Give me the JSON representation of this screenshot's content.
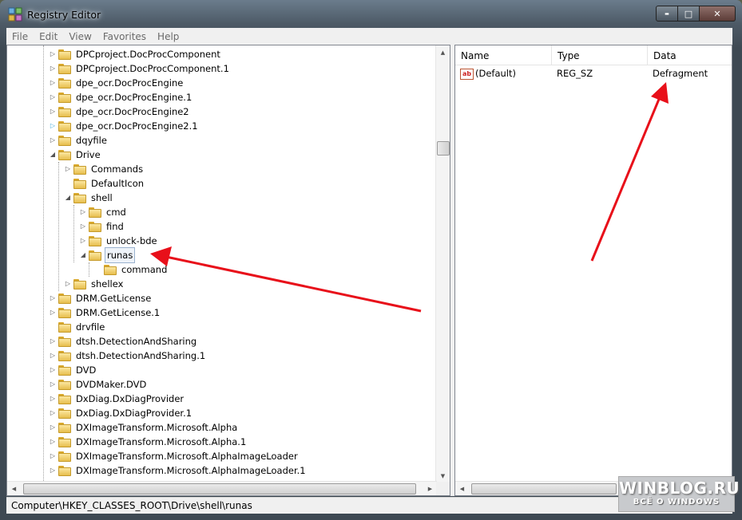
{
  "window": {
    "title": "Registry Editor",
    "icon": "regedit-icon"
  },
  "caption_buttons": {
    "minimize": "▬",
    "maximize": "□",
    "close": "✕"
  },
  "menu": [
    "File",
    "Edit",
    "View",
    "Favorites",
    "Help"
  ],
  "tree": [
    {
      "label": "DPCproject.DocProcComponent"
    },
    {
      "label": "DPCproject.DocProcComponent.1"
    },
    {
      "label": "dpe_ocr.DocProcEngine"
    },
    {
      "label": "dpe_ocr.DocProcEngine.1"
    },
    {
      "label": "dpe_ocr.DocProcEngine2"
    },
    {
      "label": "dpe_ocr.DocProcEngine2.1"
    },
    {
      "label": "dqyfile"
    },
    {
      "label": "Drive"
    },
    {
      "label": "Commands"
    },
    {
      "label": "DefaultIcon"
    },
    {
      "label": "shell"
    },
    {
      "label": "cmd"
    },
    {
      "label": "find"
    },
    {
      "label": "unlock-bde"
    },
    {
      "label": "runas"
    },
    {
      "label": "command"
    },
    {
      "label": "shellex"
    },
    {
      "label": "DRM.GetLicense"
    },
    {
      "label": "DRM.GetLicense.1"
    },
    {
      "label": "drvfile"
    },
    {
      "label": "dtsh.DetectionAndSharing"
    },
    {
      "label": "dtsh.DetectionAndSharing.1"
    },
    {
      "label": "DVD"
    },
    {
      "label": "DVDMaker.DVD"
    },
    {
      "label": "DxDiag.DxDiagProvider"
    },
    {
      "label": "DxDiag.DxDiagProvider.1"
    },
    {
      "label": "DXImageTransform.Microsoft.Alpha"
    },
    {
      "label": "DXImageTransform.Microsoft.Alpha.1"
    },
    {
      "label": "DXImageTransform.Microsoft.AlphaImageLoader"
    },
    {
      "label": "DXImageTransform.Microsoft.AlphaImageLoader.1"
    }
  ],
  "list": {
    "columns": [
      "Name",
      "Type",
      "Data"
    ],
    "rows": [
      {
        "name": "(Default)",
        "type": "REG_SZ",
        "data": "Defragment",
        "icon_text": "ab"
      }
    ]
  },
  "status": "Computer\\HKEY_CLASSES_ROOT\\Drive\\shell\\runas",
  "watermark": {
    "main": "WINBLOG.RU",
    "sub": "ВСЁ О WINDOWS"
  },
  "annotation_color": "#e8101a"
}
